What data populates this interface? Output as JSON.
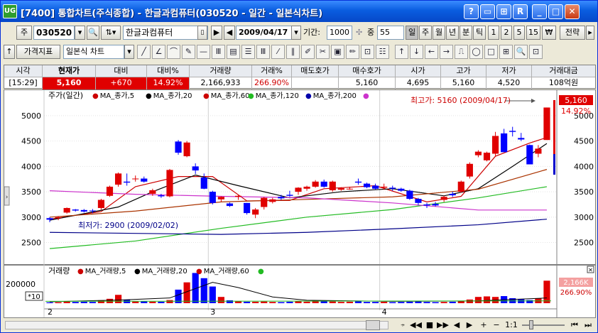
{
  "window": {
    "title": "[7400] 통합차트(주식종합) - 한글과컴퓨터(030520 - 일간 - 일본식차트)",
    "app_icon": "UG",
    "buttons": [
      "?",
      "▭",
      "⊞",
      "R",
      "_",
      "□",
      "✕"
    ]
  },
  "toolbar1": {
    "market": "주",
    "code": "030520",
    "name": "한글과컴퓨터",
    "date": "2009/04/17",
    "period_label": "기간:",
    "period_value": "1000",
    "count_label": "중",
    "count_value": "55",
    "period_buttons": [
      "일",
      "주",
      "월",
      "년",
      "분",
      "틱",
      "1",
      "2",
      "5",
      "15",
      "₩"
    ],
    "strategy": "전략"
  },
  "toolbar2": {
    "indicator": "가격지표",
    "chart_type": "일본식 차트"
  },
  "quote": {
    "headers": [
      "시각",
      "현재가",
      "대비",
      "대비%",
      "거래량",
      "거래%",
      "매도호가",
      "매수호가",
      "시가",
      "고가",
      "저가",
      "거래대금"
    ],
    "values": [
      "[15:29]",
      "5,160",
      "+670",
      "14.92%",
      "2,166,933",
      "266.90%",
      "",
      "5,160",
      "4,695",
      "5,160",
      "4,520",
      "108억원"
    ]
  },
  "price_panel": {
    "legend_title": "주가(일간)",
    "legend_items": [
      {
        "label": "MA_종가,5",
        "color": "#cc0000"
      },
      {
        "label": "MA_종가,20",
        "color": "#000000"
      },
      {
        "label": "MA_종가,60",
        "color": "#cc0000"
      },
      {
        "label": "MA_종가,120",
        "color": "#22bb22"
      },
      {
        "label": "MA_종가,200",
        "color": "#0000aa"
      }
    ],
    "high_note": "최고가: 5160 (2009/04/17)",
    "low_note": "최저가: 2900 (2009/02/02)",
    "last_price": "5,160",
    "last_change": "14.92%"
  },
  "volume_panel": {
    "legend_title": "거래량",
    "legend_items": [
      {
        "label": "MA_거래량,5",
        "color": "#cc0000"
      },
      {
        "label": "MA_거래량,20",
        "color": "#000000"
      },
      {
        "label": "MA_거래량,60",
        "color": "#cc0000"
      }
    ],
    "unit": "*10",
    "last_volume": "2,166K",
    "last_pct": "266.90%"
  },
  "colors": {
    "up": "#e00000",
    "down": "#0000ff",
    "ma5": "#cc0000",
    "ma20": "#000000",
    "ma60": "#aa3300",
    "ma120": "#22bb22",
    "ma200": "#000088",
    "mamagenta": "#cc33cc"
  },
  "chart_data": [
    {
      "type": "candlestick",
      "title": "주가(일간)",
      "x_labels": [
        "2",
        "3",
        "4"
      ],
      "y_ticks": [
        2500,
        3000,
        3500,
        4000,
        4500,
        5000
      ],
      "ylim": [
        2200,
        5250
      ],
      "candles": [
        [
          2980,
          3000,
          2900,
          2950
        ],
        [
          2980,
          3020,
          2940,
          3000
        ],
        [
          3090,
          3190,
          3070,
          3180
        ],
        [
          3150,
          3160,
          3110,
          3130
        ],
        [
          3140,
          3160,
          3090,
          3110
        ],
        [
          3130,
          3160,
          3080,
          3120
        ],
        [
          3180,
          3360,
          3150,
          3340
        ],
        [
          3420,
          3620,
          3400,
          3600
        ],
        [
          3640,
          3880,
          3600,
          3860
        ],
        [
          3700,
          3860,
          3620,
          3680
        ],
        [
          3750,
          3820,
          3700,
          3760
        ],
        [
          3760,
          3800,
          3680,
          3700
        ],
        [
          3460,
          3560,
          3420,
          3530
        ],
        [
          3430,
          3460,
          3380,
          3410
        ],
        [
          3410,
          3950,
          3390,
          3930
        ],
        [
          4490,
          4520,
          4230,
          4270
        ],
        [
          4200,
          4500,
          4180,
          4470
        ],
        [
          4000,
          4060,
          3850,
          3920
        ],
        [
          3780,
          3860,
          3550,
          3560
        ],
        [
          3500,
          3520,
          3250,
          3280
        ],
        [
          3350,
          3410,
          3300,
          3400
        ],
        [
          3270,
          3290,
          3200,
          3220
        ],
        [
          3400,
          3430,
          3340,
          3420
        ],
        [
          3280,
          3280,
          3050,
          3080
        ],
        [
          3050,
          3180,
          2980,
          3150
        ],
        [
          3200,
          3400,
          3150,
          3380
        ],
        [
          3300,
          3380,
          3270,
          3350
        ],
        [
          3400,
          3440,
          3340,
          3370
        ],
        [
          3440,
          3520,
          3400,
          3420
        ],
        [
          3500,
          3590,
          3440,
          3580
        ],
        [
          3560,
          3620,
          3520,
          3600
        ],
        [
          3600,
          3730,
          3580,
          3700
        ],
        [
          3700,
          3740,
          3580,
          3600
        ],
        [
          3530,
          3720,
          3500,
          3700
        ],
        [
          3540,
          3590,
          3520,
          3570
        ],
        [
          3560,
          3600,
          3540,
          3560
        ],
        [
          3700,
          3760,
          3640,
          3680
        ],
        [
          3660,
          3680,
          3570,
          3590
        ],
        [
          3620,
          3660,
          3540,
          3560
        ],
        [
          3580,
          3660,
          3540,
          3600
        ],
        [
          3580,
          3620,
          3520,
          3560
        ],
        [
          3560,
          3580,
          3500,
          3520
        ],
        [
          3520,
          3540,
          3340,
          3360
        ],
        [
          3360,
          3380,
          3240,
          3280
        ],
        [
          3250,
          3280,
          3180,
          3230
        ],
        [
          3260,
          3300,
          3210,
          3230
        ],
        [
          3340,
          3420,
          3300,
          3400
        ],
        [
          3460,
          3500,
          3400,
          3430
        ],
        [
          3500,
          3720,
          3480,
          3700
        ],
        [
          3800,
          4080,
          3760,
          4050
        ],
        [
          4220,
          4320,
          4180,
          4290
        ],
        [
          4120,
          4290,
          4100,
          4270
        ],
        [
          4250,
          4680,
          4200,
          4600
        ],
        [
          4650,
          4740,
          4550,
          4280
        ],
        [
          4700,
          4780,
          4590,
          4680
        ],
        [
          4560,
          4660,
          4500,
          4530
        ],
        [
          4420,
          4430,
          4120,
          4040
        ],
        [
          4250,
          4420,
          4180,
          4350
        ],
        [
          4520,
          5160,
          4520,
          5160
        ]
      ],
      "ma_lines": {
        "ma5": [
          [
            0,
            2960
          ],
          [
            6,
            3110
          ],
          [
            10,
            3600
          ],
          [
            15,
            3800
          ],
          [
            19,
            3800
          ],
          [
            23,
            3320
          ],
          [
            28,
            3330
          ],
          [
            32,
            3560
          ],
          [
            38,
            3620
          ],
          [
            44,
            3300
          ],
          [
            48,
            3410
          ],
          [
            52,
            4200
          ],
          [
            56,
            4460
          ],
          [
            58,
            4570
          ]
        ],
        "ma20": [
          [
            0,
            2940
          ],
          [
            8,
            3200
          ],
          [
            12,
            3500
          ],
          [
            17,
            3830
          ],
          [
            22,
            3620
          ],
          [
            28,
            3380
          ],
          [
            34,
            3500
          ],
          [
            40,
            3560
          ],
          [
            46,
            3420
          ],
          [
            50,
            3560
          ],
          [
            54,
            4000
          ],
          [
            58,
            4450
          ]
        ],
        "ma60": [
          [
            0,
            3000
          ],
          [
            10,
            3120
          ],
          [
            20,
            3300
          ],
          [
            30,
            3350
          ],
          [
            40,
            3400
          ],
          [
            50,
            3550
          ],
          [
            58,
            3940
          ]
        ],
        "ma120": [
          [
            0,
            2380
          ],
          [
            10,
            2530
          ],
          [
            20,
            2780
          ],
          [
            30,
            3000
          ],
          [
            40,
            3150
          ],
          [
            50,
            3380
          ],
          [
            58,
            3600
          ]
        ],
        "ma200": [
          [
            0,
            2700
          ],
          [
            10,
            2680
          ],
          [
            20,
            2660
          ],
          [
            30,
            2700
          ],
          [
            40,
            2770
          ],
          [
            50,
            2850
          ],
          [
            58,
            2960
          ]
        ],
        "magenta": [
          [
            0,
            3520
          ],
          [
            10,
            3450
          ],
          [
            20,
            3410
          ],
          [
            30,
            3380
          ],
          [
            40,
            3280
          ],
          [
            50,
            3140
          ],
          [
            58,
            3140
          ]
        ]
      }
    },
    {
      "type": "bar",
      "title": "거래량",
      "y_ticks": [
        200000
      ],
      "ylim": [
        0,
        300000
      ],
      "volumes": [
        8000,
        9000,
        18000,
        12000,
        14000,
        12000,
        28000,
        42000,
        80000,
        34000,
        16000,
        20000,
        15000,
        14000,
        30000,
        130000,
        200000,
        290000,
        240000,
        160000,
        60000,
        28000,
        20000,
        14000,
        14000,
        16000,
        12000,
        10000,
        14000,
        18000,
        14000,
        22000,
        20000,
        16000,
        12000,
        14000,
        18000,
        12000,
        12000,
        14000,
        10000,
        12000,
        14000,
        16000,
        12000,
        10000,
        12000,
        14000,
        20000,
        35000,
        60000,
        65000,
        60000,
        68000,
        48000,
        40000,
        30000,
        45000,
        216000
      ],
      "ma20": [
        [
          0,
          14000
        ],
        [
          8,
          30000
        ],
        [
          14,
          50000
        ],
        [
          17,
          140000
        ],
        [
          19,
          200000
        ],
        [
          22,
          150000
        ],
        [
          26,
          60000
        ],
        [
          30,
          28000
        ],
        [
          40,
          18000
        ],
        [
          50,
          22000
        ],
        [
          58,
          50000
        ]
      ]
    }
  ]
}
